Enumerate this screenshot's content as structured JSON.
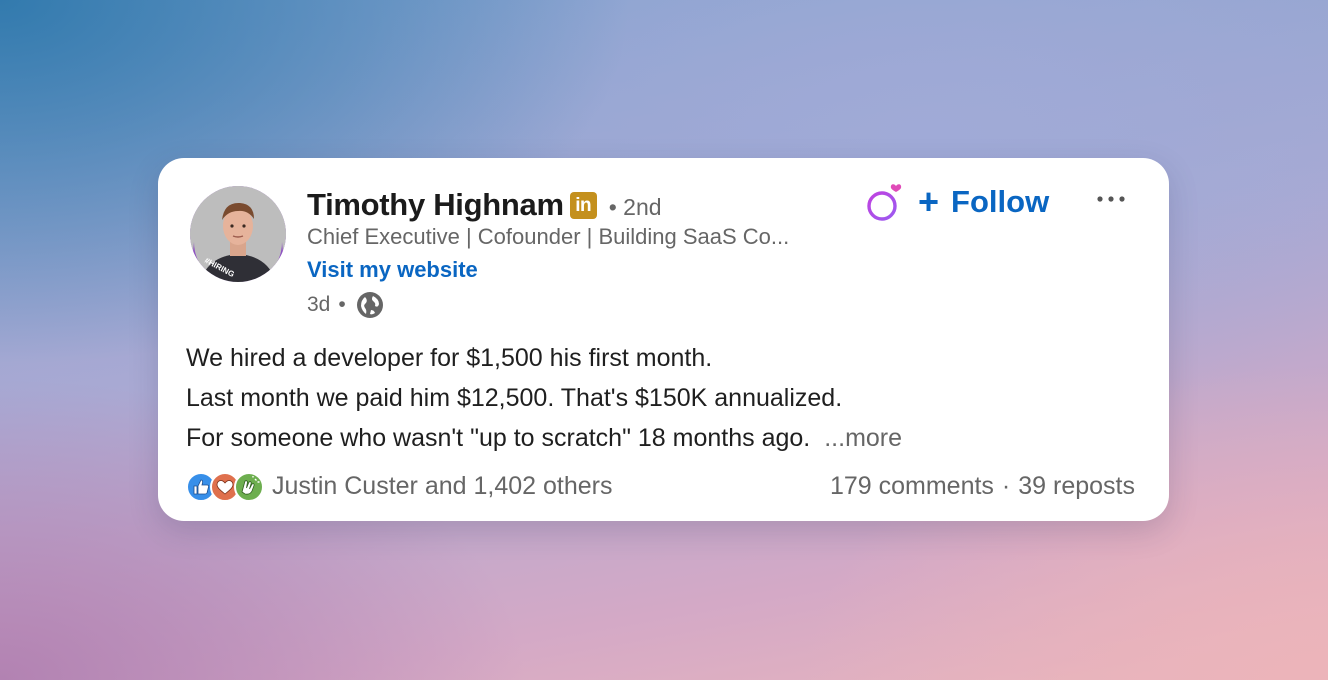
{
  "post": {
    "author": {
      "name": "Timothy Highnam",
      "badge": "in",
      "degree": "2nd",
      "headline": "Chief Executive | Cofounder | Building SaaS Co...",
      "website_label": "Visit my website",
      "avatar_tag": "#HIRING"
    },
    "meta": {
      "age": "3d",
      "separator": "•",
      "visibility_icon": "globe-icon"
    },
    "follow": {
      "label": "Follow",
      "plus": "+",
      "ring_icon": "purple-ring-heart-icon"
    },
    "menu_icon": "more-dots-icon",
    "body_lines": [
      "We hired a developer for $1,500 his first month.",
      "Last month we paid him $12,500. That's $150K annualized.",
      "For someone who wasn't \"up to scratch\" 18 months ago."
    ],
    "see_more": "...more",
    "reactions": {
      "icons": [
        "like-icon",
        "love-icon",
        "celebrate-icon"
      ],
      "summary": "Justin Custer and 1,402 others"
    },
    "stats": {
      "comments": "179 comments",
      "dot": "·",
      "reposts": "39 reposts"
    }
  },
  "colors": {
    "link_blue": "#0a66c2",
    "badge_gold": "#c4901d",
    "avatar_purple": "#8e4fc4",
    "muted_text": "#666666"
  }
}
